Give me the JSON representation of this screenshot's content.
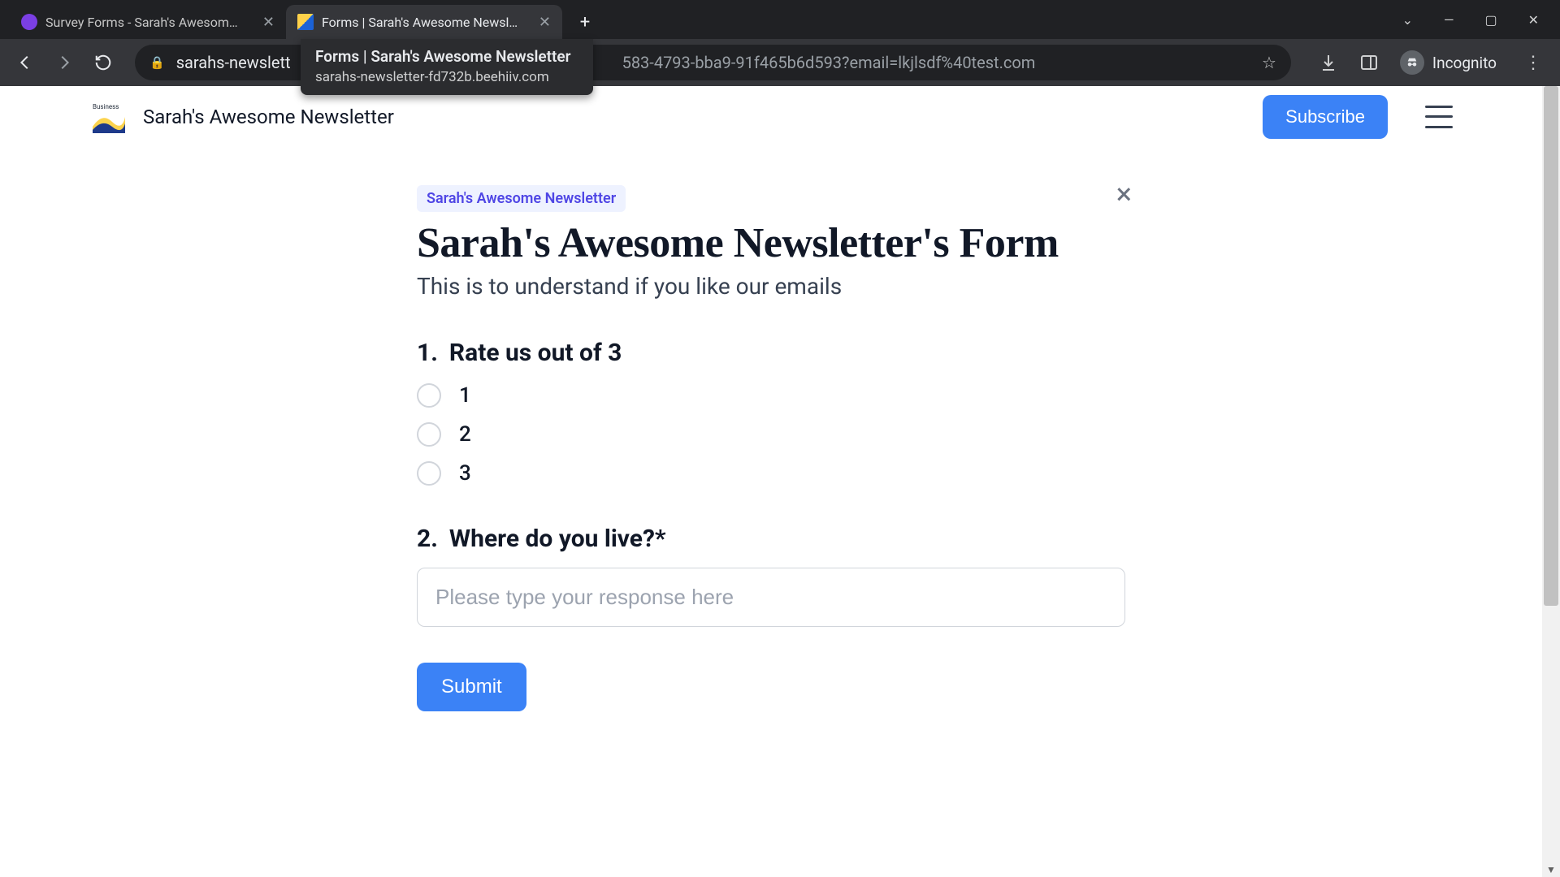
{
  "browser": {
    "tabs": [
      {
        "title": "Survey Forms - Sarah's Awesom…"
      },
      {
        "title": "Forms | Sarah's Awesome Newsl…"
      }
    ],
    "tooltip": {
      "title": "Forms | Sarah's Awesome Newsletter",
      "url": "sarahs-newsletter-fd732b.beehiiv.com"
    },
    "url_visible_left": "sarahs-newslett",
    "url_visible_right": "583-4793-bba9-91f465b6d593?email=lkjlsdf%40test.com",
    "incognito_label": "Incognito"
  },
  "site": {
    "title": "Sarah's Awesome Newsletter",
    "subscribe": "Subscribe"
  },
  "form": {
    "badge": "Sarah's Awesome Newsletter",
    "title": "Sarah's Awesome Newsletter's Form",
    "subtitle": "This is to understand if you like our emails",
    "questions": [
      {
        "number": "1.",
        "text": "Rate us out of 3",
        "options": [
          "1",
          "2",
          "3"
        ]
      },
      {
        "number": "2.",
        "text": "Where do you live?*",
        "placeholder": "Please type your response here"
      }
    ],
    "submit": "Submit"
  }
}
